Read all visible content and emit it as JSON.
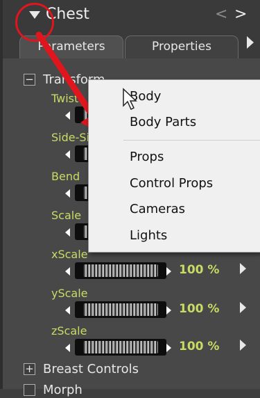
{
  "panel": {
    "title": "Chest",
    "nav_prev": "<",
    "nav_next": ">"
  },
  "tabs": [
    {
      "label": "Parameters"
    },
    {
      "label": "Properties"
    }
  ],
  "groups": {
    "transform": {
      "toggle": "−",
      "label": "Transform"
    },
    "breast_controls": {
      "toggle": "+",
      "label": "Breast Controls"
    },
    "morph": {
      "label": "Morph"
    }
  },
  "parameters": [
    {
      "label": "Twist",
      "value": ""
    },
    {
      "label": "Side-Side",
      "value": ""
    },
    {
      "label": "Bend",
      "value": ""
    },
    {
      "label": "Scale",
      "value": ""
    },
    {
      "label": "xScale",
      "value": "100 %"
    },
    {
      "label": "yScale",
      "value": "100 %"
    },
    {
      "label": "zScale",
      "value": "100 %"
    }
  ],
  "context_menu": {
    "items": [
      "Body",
      "Body Parts",
      "Props",
      "Control Props",
      "Cameras",
      "Lights"
    ]
  },
  "colors": {
    "annotation": "#e0161e",
    "param_label": "#c8dc64"
  }
}
